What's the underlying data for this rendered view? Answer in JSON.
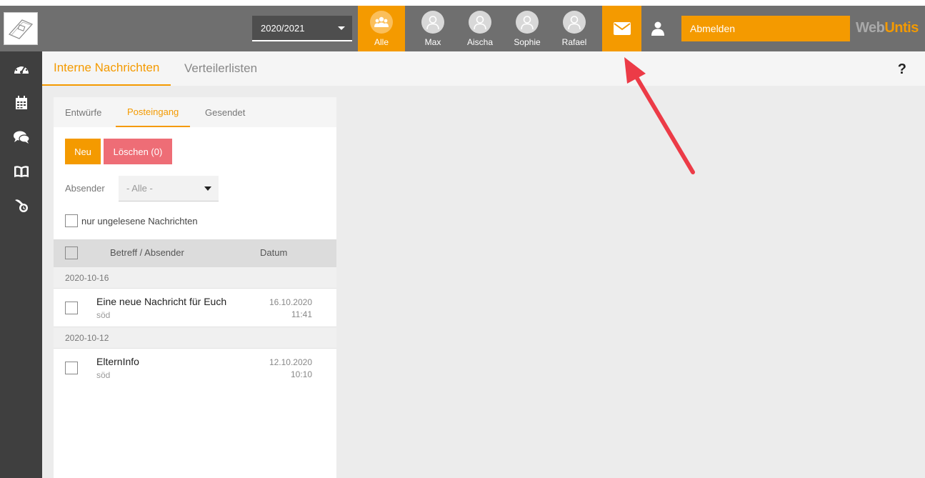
{
  "topbar": {
    "school_year": "2020/2021",
    "people": [
      {
        "label": "Alle",
        "active": true
      },
      {
        "label": "Max",
        "active": false
      },
      {
        "label": "Aischa",
        "active": false
      },
      {
        "label": "Sophie",
        "active": false
      },
      {
        "label": "Rafael",
        "active": false
      }
    ],
    "logout_label": "Abmelden",
    "brand_web": "Web",
    "brand_untis": "Untis"
  },
  "sidebar": {
    "icons": [
      "dashboard-icon",
      "calendar-icon",
      "chat-icon",
      "book-icon",
      "support-icon"
    ]
  },
  "pagetabs": {
    "internal": "Interne Nachrichten",
    "lists": "Verteilerlisten",
    "help": "?"
  },
  "messages": {
    "tabs": [
      "Entwürfe",
      "Posteingang",
      "Gesendet"
    ],
    "active_tab": "Posteingang",
    "new_label": "Neu",
    "delete_label": "Löschen (0)",
    "sender_filter_label": "Absender",
    "sender_filter_value": "- Alle -",
    "unread_only_label": "nur ungelesene Nachrichten",
    "columns": {
      "subject": "Betreff / Absender",
      "date": "Datum"
    },
    "groups": [
      {
        "date": "2020-10-16",
        "items": [
          {
            "subject": "Eine neue Nachricht für Euch",
            "sender": "söd",
            "date": "16.10.2020",
            "time": "11:41"
          }
        ]
      },
      {
        "date": "2020-10-12",
        "items": [
          {
            "subject": "ElternInfo",
            "sender": "söd",
            "date": "12.10.2020",
            "time": "10:10"
          }
        ]
      }
    ]
  },
  "colors": {
    "accent": "#f49a00",
    "danger": "#ee6d76",
    "topbar": "#6f6f6f",
    "sidebar": "#3f3f3f",
    "annotation_arrow": "#ec3b47"
  }
}
